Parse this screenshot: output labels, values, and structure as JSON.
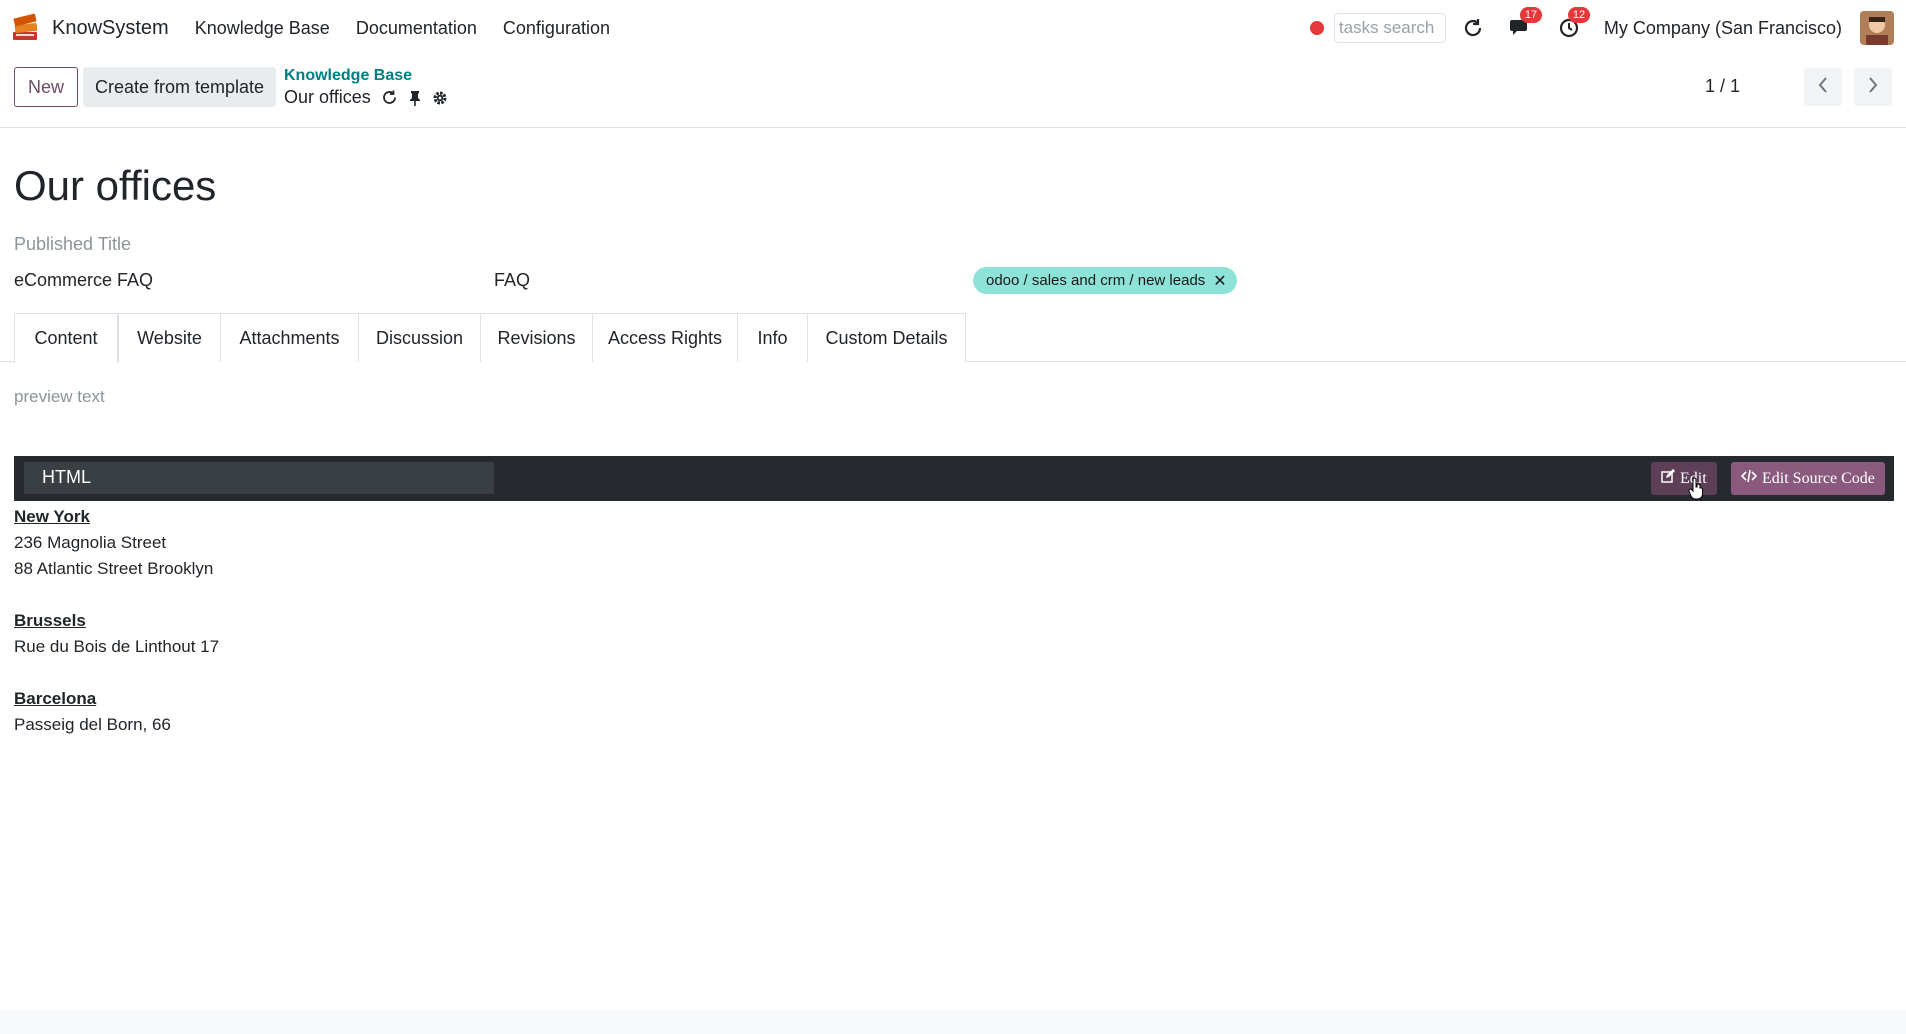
{
  "navbar": {
    "app_name": "KnowSystem",
    "menu": [
      "Knowledge Base",
      "Documentation",
      "Configuration"
    ],
    "search_placeholder": "tasks search",
    "messages_count": "17",
    "activities_count": "12",
    "company": "My Company (San Francisco)"
  },
  "control_panel": {
    "new_label": "New",
    "template_label": "Create from template",
    "breadcrumb_parent": "Knowledge Base",
    "breadcrumb_current": "Our offices",
    "pager": "1 / 1"
  },
  "form": {
    "title": "Our offices",
    "published_title_placeholder": "Published Title",
    "field_section": "eCommerce FAQ",
    "field_type": "FAQ",
    "tag": "odoo / sales and crm / new leads"
  },
  "tabs": [
    "Content",
    "Website",
    "Attachments",
    "Discussion",
    "Revisions",
    "Access Rights",
    "Info",
    "Custom Details"
  ],
  "content_tab": {
    "preview_placeholder": "preview text",
    "editor_mode": "HTML",
    "edit_label": "Edit",
    "edit_source_label": "Edit Source Code"
  },
  "offices": [
    {
      "city": "New York",
      "lines": [
        "236 Magnolia Street",
        "88 Atlantic Street Brooklyn"
      ]
    },
    {
      "city": "Brussels",
      "lines": [
        "Rue du Bois de Linthout 17"
      ]
    },
    {
      "city": "Barcelona",
      "lines": [
        "Passeig del Born, 66"
      ]
    }
  ],
  "colors": {
    "brand": "#714b67",
    "link": "#017e84",
    "tag_bg": "#8ee3d8",
    "badge": "#e5383b",
    "toolbar": "#262a2e"
  }
}
